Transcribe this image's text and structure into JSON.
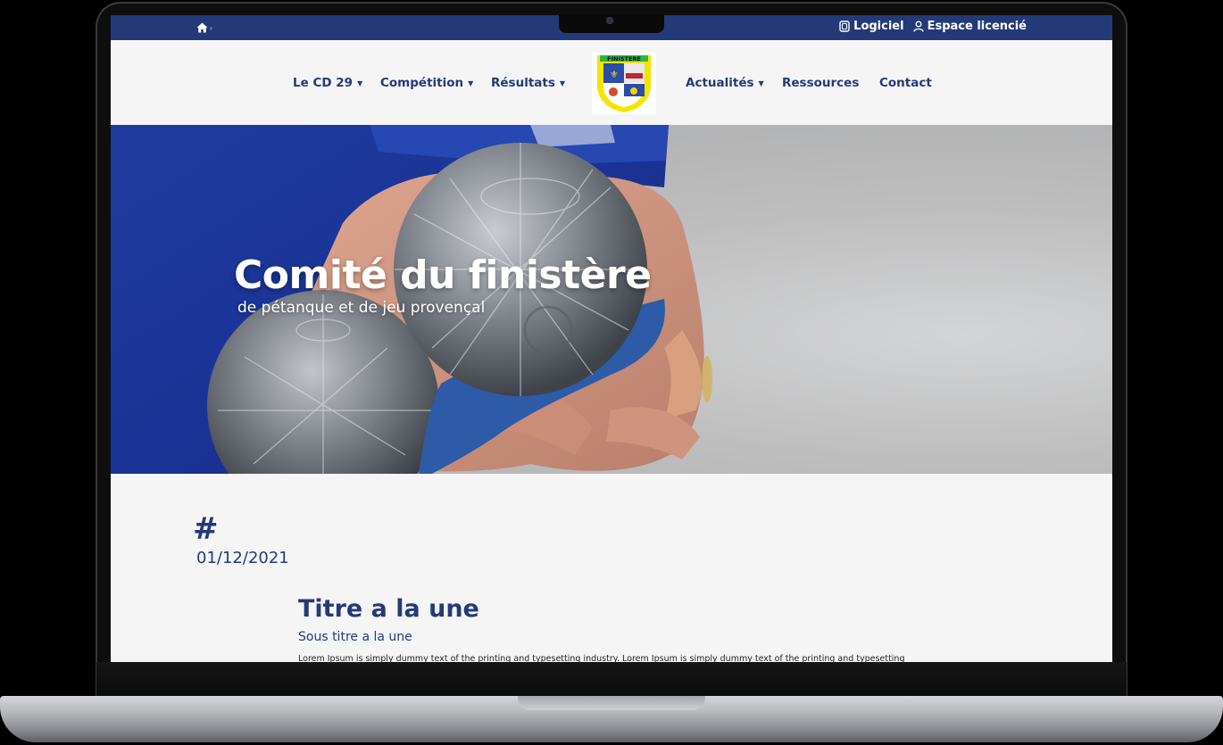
{
  "topbar": {
    "home_icon": "home-icon",
    "links": [
      {
        "label": "Logiciel",
        "icon": "software-icon"
      },
      {
        "label": "Espace licencié",
        "icon": "user-icon"
      }
    ]
  },
  "nav": {
    "left_items": [
      {
        "label": "Le CD 29",
        "has_dropdown": true
      },
      {
        "label": "Compétition",
        "has_dropdown": true
      },
      {
        "label": "Résultats",
        "has_dropdown": true
      }
    ],
    "logo_text": "FINISTERE",
    "right_items": [
      {
        "label": "Actualités",
        "has_dropdown": true
      },
      {
        "label": "Ressources",
        "has_dropdown": false
      },
      {
        "label": "Contact",
        "has_dropdown": false
      }
    ]
  },
  "hero": {
    "title": "Comité du finistère",
    "subtitle": "de pétanque et de jeu provençal"
  },
  "article": {
    "hash": "#",
    "date": "01/12/2021",
    "title": "Titre a la une",
    "subtitle": "Sous titre a la une",
    "body": "Lorem Ipsum is simply dummy text of the printing and typesetting industry. Lorem Ipsum is simply dummy text of the printing and typesetting"
  },
  "colors": {
    "brand_blue": "#243a78",
    "page_bg": "#f5f5f6"
  }
}
